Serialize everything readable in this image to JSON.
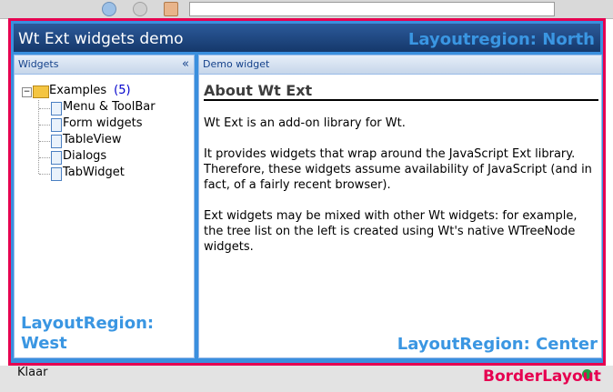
{
  "app": {
    "title": "Wt Ext widgets demo"
  },
  "status": {
    "text": "Klaar"
  },
  "annotations": {
    "north": "Layoutregion: North",
    "west": "LayoutRegion: West",
    "center": "LayoutRegion: Center",
    "border": "BorderLayout"
  },
  "west_panel": {
    "title": "Widgets",
    "collapse_glyph": "«",
    "tree": {
      "root_label": "Examples",
      "root_count": "(5)",
      "items": [
        "Menu & ToolBar",
        "Form widgets",
        "TableView",
        "Dialogs",
        "TabWidget"
      ]
    }
  },
  "center_panel": {
    "title": "Demo widget",
    "heading": "About Wt Ext",
    "paragraphs": [
      "Wt Ext is an add-on library for Wt.",
      "It provides widgets that wrap around the JavaScript Ext library. Therefore, these widgets assume availability of JavaScript (and in fact, of a fairly recent browser).",
      "Ext widgets may be mixed with other Wt widgets: for example, the tree list on the left is created using Wt's native WTreeNode widgets."
    ]
  },
  "colors": {
    "annotation": "#3a96e2",
    "border_layout": "#e60050",
    "north_bg": "#15386b"
  }
}
